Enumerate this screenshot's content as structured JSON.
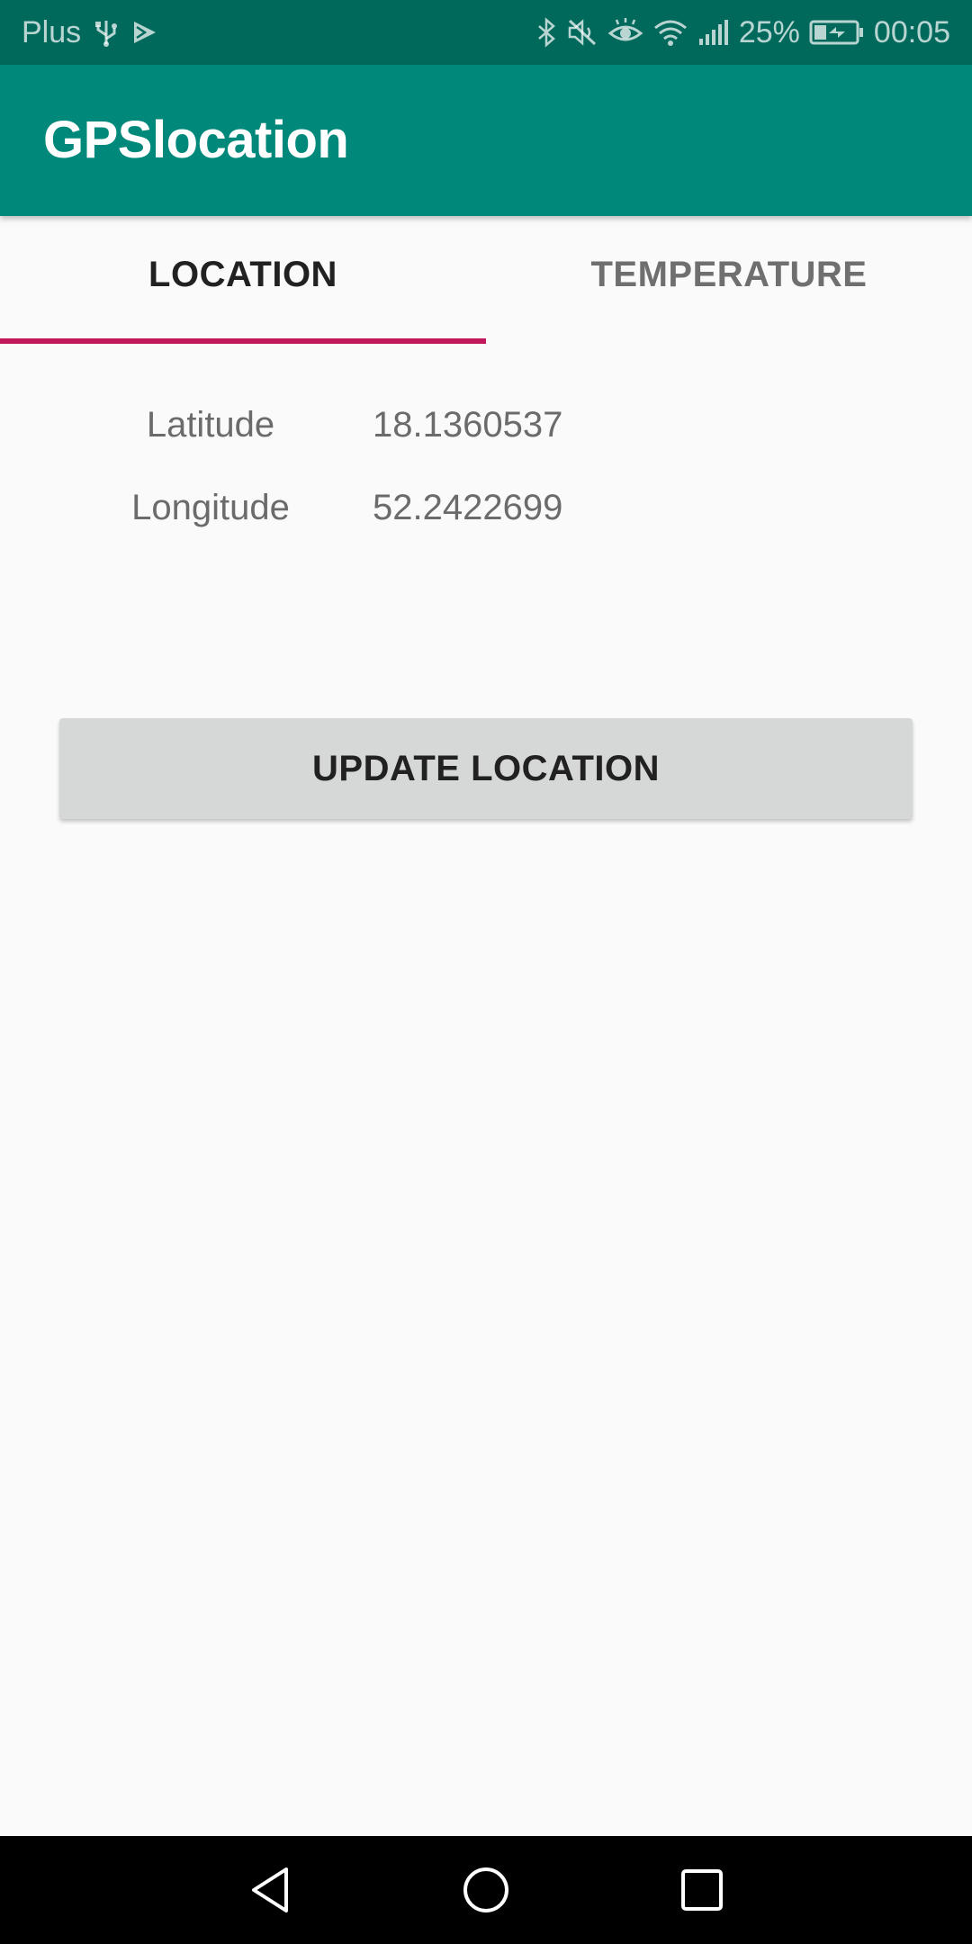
{
  "status_bar": {
    "carrier": "Plus",
    "battery_percent": "25%",
    "time": "00:05",
    "icons_left": [
      "usb-icon",
      "play-store-icon"
    ],
    "icons_right": [
      "bluetooth-icon",
      "mute-icon",
      "eye-comfort-icon",
      "wifi-icon",
      "signal-icon",
      "battery-charging-icon"
    ]
  },
  "app_bar": {
    "title": "GPSlocation"
  },
  "tabs": [
    {
      "label": "LOCATION",
      "selected": true
    },
    {
      "label": "TEMPERATURE",
      "selected": false
    }
  ],
  "location": {
    "latitude_label": "Latitude",
    "latitude_value": "18.1360537",
    "longitude_label": "Longitude",
    "longitude_value": "52.2422699"
  },
  "update_button": {
    "label": "UPDATE LOCATION"
  },
  "nav_bar": {
    "icons": [
      "back-icon",
      "home-icon",
      "recents-icon"
    ]
  },
  "colors": {
    "status_bar": "#00695c",
    "app_bar": "#00897b",
    "tab_indicator": "#c2185b",
    "button": "#d6d7d7",
    "background": "#fafafa"
  }
}
